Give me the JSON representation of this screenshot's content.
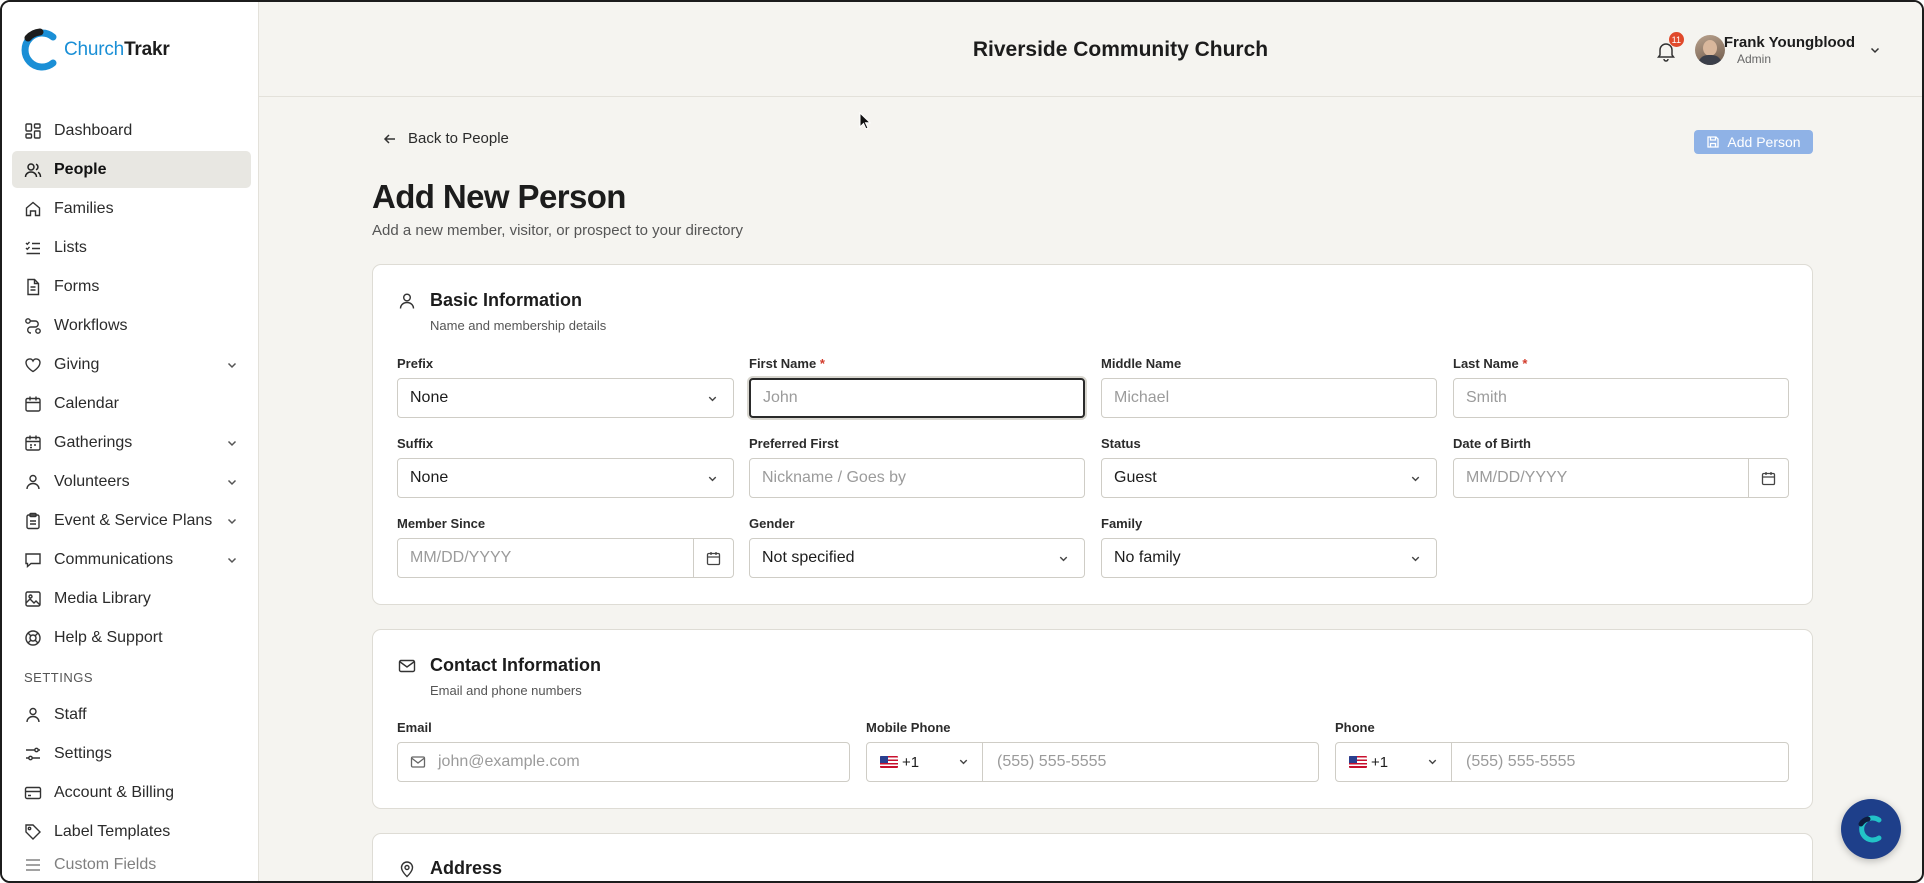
{
  "app": {
    "logo_part1": "Church",
    "logo_part2": "Trakr"
  },
  "sidebar": {
    "items": [
      {
        "label": "Dashboard",
        "icon": "dashboard-icon"
      },
      {
        "label": "People",
        "icon": "users-icon",
        "active": true
      },
      {
        "label": "Families",
        "icon": "home-icon"
      },
      {
        "label": "Lists",
        "icon": "list-check-icon"
      },
      {
        "label": "Forms",
        "icon": "file-text-icon"
      },
      {
        "label": "Workflows",
        "icon": "workflow-icon"
      },
      {
        "label": "Giving",
        "icon": "heart-icon",
        "expandable": true
      },
      {
        "label": "Calendar",
        "icon": "calendar-icon"
      },
      {
        "label": "Gatherings",
        "icon": "gatherings-icon",
        "expandable": true
      },
      {
        "label": "Volunteers",
        "icon": "volunteers-icon",
        "expandable": true
      },
      {
        "label": "Event & Service Plans",
        "icon": "clipboard-icon",
        "expandable": true
      },
      {
        "label": "Communications",
        "icon": "chat-icon",
        "expandable": true
      },
      {
        "label": "Media Library",
        "icon": "image-icon"
      },
      {
        "label": "Help & Support",
        "icon": "lifebuoy-icon"
      }
    ],
    "settings_heading": "SETTINGS",
    "settings_items": [
      {
        "label": "Staff",
        "icon": "staff-icon"
      },
      {
        "label": "Settings",
        "icon": "sliders-icon"
      },
      {
        "label": "Account & Billing",
        "icon": "credit-card-icon"
      },
      {
        "label": "Label Templates",
        "icon": "tag-icon"
      },
      {
        "label": "Custom Fields",
        "icon": "custom-fields-icon"
      }
    ]
  },
  "header": {
    "org_name": "Riverside Community Church",
    "notification_count": "11",
    "user_name": "Frank Youngblood",
    "user_role": "Admin"
  },
  "main": {
    "back_label": "Back to People",
    "add_button_label": "Add Person",
    "title": "Add New Person",
    "subtitle": "Add a new member, visitor, or prospect to your directory"
  },
  "basic": {
    "title": "Basic Information",
    "subtitle": "Name and membership details",
    "prefix": {
      "label": "Prefix",
      "value": "None"
    },
    "first_name": {
      "label": "First Name",
      "required": "*",
      "placeholder": "John"
    },
    "middle_name": {
      "label": "Middle Name",
      "placeholder": "Michael"
    },
    "last_name": {
      "label": "Last Name",
      "required": "*",
      "placeholder": "Smith"
    },
    "suffix": {
      "label": "Suffix",
      "value": "None"
    },
    "preferred_first": {
      "label": "Preferred First",
      "placeholder": "Nickname / Goes by"
    },
    "status": {
      "label": "Status",
      "value": "Guest"
    },
    "dob": {
      "label": "Date of Birth",
      "placeholder": "MM/DD/YYYY"
    },
    "member_since": {
      "label": "Member Since",
      "placeholder": "MM/DD/YYYY"
    },
    "gender": {
      "label": "Gender",
      "value": "Not specified"
    },
    "family": {
      "label": "Family",
      "value": "No family"
    }
  },
  "contact": {
    "title": "Contact Information",
    "subtitle": "Email and phone numbers",
    "email": {
      "label": "Email",
      "placeholder": "john@example.com"
    },
    "mobile": {
      "label": "Mobile Phone",
      "country_code": "+1",
      "placeholder": "(555) 555-5555"
    },
    "phone": {
      "label": "Phone",
      "country_code": "+1",
      "placeholder": "(555) 555-5555"
    }
  },
  "address": {
    "title": "Address"
  },
  "colors": {
    "accent": "#1a8fd6",
    "primary_button": "#8fb2e6",
    "badge": "#e0492b",
    "fab": "#1e3f8a"
  }
}
